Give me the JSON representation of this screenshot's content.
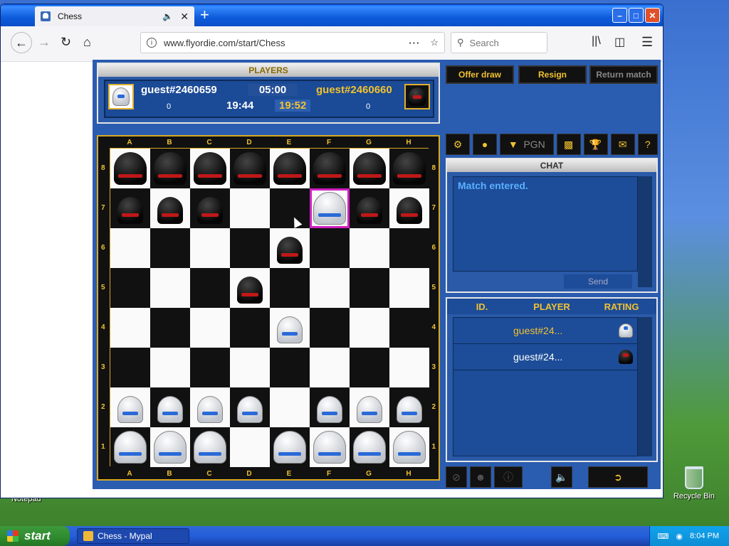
{
  "browser": {
    "tab_title": "Chess",
    "url": "www.flyordie.com/start/Chess",
    "search_placeholder": "Search",
    "icons": [
      "back-icon",
      "forward-icon",
      "reload-icon",
      "home-icon",
      "library-icon",
      "sidebar-icon",
      "menu-icon"
    ]
  },
  "players": {
    "header": "PLAYERS",
    "white": {
      "name": "guest#2460659",
      "score": "0",
      "time": "19:44"
    },
    "black": {
      "name": "guest#2460660",
      "score": "0",
      "time": "19:52"
    },
    "time_control": "05:00"
  },
  "buttons": {
    "offer_draw": "Offer draw",
    "resign": "Resign",
    "return_match": "Return match"
  },
  "board": {
    "files": [
      "A",
      "B",
      "C",
      "D",
      "E",
      "F",
      "G",
      "H"
    ],
    "ranks": [
      "8",
      "7",
      "6",
      "5",
      "4",
      "3",
      "2",
      "1"
    ],
    "highlight": "f7",
    "pieces": {
      "a8": "bR",
      "b8": "bN",
      "c8": "bB",
      "d8": "bQ",
      "e8": "bK",
      "f8": "bB",
      "g8": "bN",
      "h8": "bR",
      "a7": "bP",
      "b7": "bP",
      "c7": "bP",
      "f7": "wQ",
      "g7": "bP",
      "h7": "bP",
      "e6": "bP",
      "d5": "bP",
      "e4": "wP",
      "a2": "wP",
      "b2": "wP",
      "c2": "wP",
      "d2": "wP",
      "f2": "wP",
      "g2": "wP",
      "h2": "wP",
      "a1": "wR",
      "b1": "wN",
      "c1": "wB",
      "e1": "wK",
      "f1": "wB",
      "g1": "wN",
      "h1": "wR"
    }
  },
  "toolbar": {
    "pgn": "PGN"
  },
  "chat": {
    "header": "CHAT",
    "messages": [
      "Match entered."
    ],
    "send_label": "Send"
  },
  "player_list": {
    "columns": [
      "ID.",
      "PLAYER",
      "RATING"
    ],
    "rows": [
      {
        "name": "guest#24...",
        "color": "white"
      },
      {
        "name": "guest#24...",
        "color": "black"
      }
    ]
  },
  "desktop": {
    "recycle_bin": "Recycle Bin",
    "notepad": "Notepad"
  },
  "taskbar": {
    "start": "start",
    "task": "Chess - Mypal",
    "clock": "8:04 PM"
  }
}
